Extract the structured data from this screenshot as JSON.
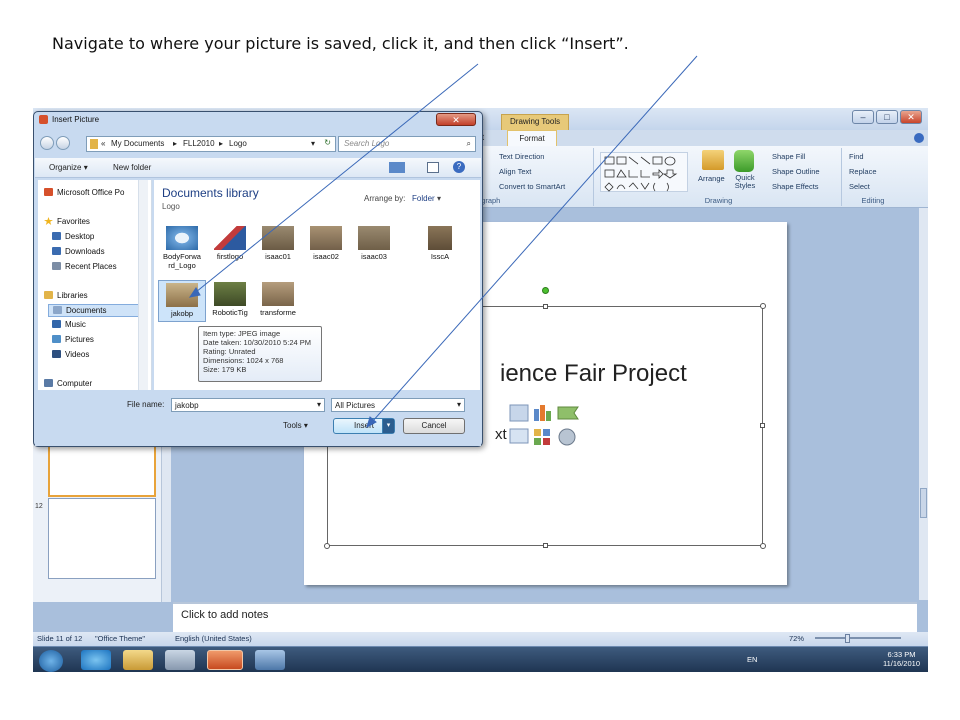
{
  "caption": "Navigate to where your picture is saved, click it, and then click “Insert”.",
  "ppt": {
    "context_tab": "Drawing Tools",
    "tabs": [
      "bat",
      "Format"
    ],
    "groups": {
      "paragraph": {
        "label": "agraph",
        "text_direction": "Text Direction",
        "align_text": "Align Text",
        "convert_smartart": "Convert to SmartArt"
      },
      "drawing": {
        "label": "Drawing",
        "arrange": "Arrange",
        "quick_styles": "Quick Styles",
        "shape_fill": "Shape Fill",
        "shape_outline": "Shape Outline",
        "shape_effects": "Shape Effects"
      },
      "editing": {
        "label": "Editing",
        "find": "Find",
        "replace": "Replace",
        "select": "Select"
      }
    },
    "slide_title": "ience Fair Project",
    "content_placeholder": "xt",
    "thumb_number": "12",
    "notes": "Click to add notes",
    "status": {
      "slide": "Slide 11 of 12",
      "theme": "\"Office Theme\"",
      "language": "English (United States)",
      "zoom": "72%"
    },
    "window_buttons": [
      "–",
      "□",
      "✕"
    ]
  },
  "taskbar": {
    "lang": "EN",
    "time": "6:33 PM",
    "date": "11/16/2010"
  },
  "dialog": {
    "title": "Insert Picture",
    "breadcrumb": [
      "My Documents",
      "FLL2010",
      "Logo"
    ],
    "search_placeholder": "Search Logo",
    "organize": "Organize",
    "new_folder": "New folder",
    "nav_items": [
      {
        "label": "Microsoft Office Po",
        "icon": "office-icon",
        "color": "#d6502b"
      },
      {
        "label": "Favorites",
        "icon": "star-icon",
        "color": "#f0b51f"
      },
      {
        "label": "Desktop",
        "icon": "desktop-icon",
        "color": "#3a6bb0"
      },
      {
        "label": "Downloads",
        "icon": "downloads-icon",
        "color": "#3a6bb0"
      },
      {
        "label": "Recent Places",
        "icon": "recent-places-icon",
        "color": "#7c8da5"
      },
      {
        "label": "Libraries",
        "icon": "libraries-icon",
        "color": "#e2b449"
      },
      {
        "label": "Documents",
        "icon": "documents-icon",
        "color": "#8ba6c9"
      },
      {
        "label": "Music",
        "icon": "music-icon",
        "color": "#3366aa"
      },
      {
        "label": "Pictures",
        "icon": "pictures-icon",
        "color": "#4f8fc8"
      },
      {
        "label": "Videos",
        "icon": "videos-icon",
        "color": "#2d4f7f"
      },
      {
        "label": "Computer",
        "icon": "computer-icon",
        "color": "#5a7aa5"
      }
    ],
    "library_title": "Documents library",
    "library_sub": "Logo",
    "arrange_label": "Arrange by:",
    "arrange_value": "Folder",
    "files": [
      {
        "name": "BodyForwa rd_Logo",
        "color": "#6aa2d8"
      },
      {
        "name": "firstlogo",
        "color": "#c23b3b"
      },
      {
        "name": "isaac01",
        "color": "#7b6a52"
      },
      {
        "name": "isaac02",
        "color": "#8a7558"
      },
      {
        "name": "isaac03",
        "color": "#7d6b55"
      },
      {
        "name": "IsscA",
        "color": "#6f5f4b"
      },
      {
        "name": "jakobp",
        "color": "#a98a5a"
      },
      {
        "name": "RoboticTig",
        "color": "#5a6b3a"
      },
      {
        "name": "transforme",
        "color": "#9a8466"
      }
    ],
    "tooltip": [
      "Item type: JPEG image",
      "Date taken: 10/30/2010 5:24 PM",
      "Rating: Unrated",
      "Dimensions: 1024 x 768",
      "Size: 179 KB"
    ],
    "file_name_label": "File name:",
    "file_name_value": "jakobp",
    "file_type": "All Pictures",
    "tools": "Tools",
    "insert": "Insert",
    "cancel": "Cancel"
  }
}
